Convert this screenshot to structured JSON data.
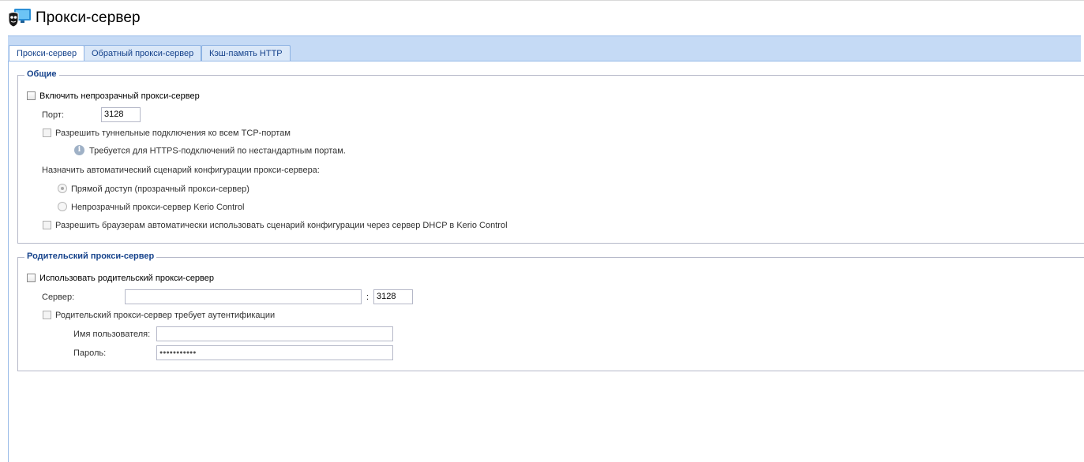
{
  "header": {
    "title": "Прокси-сервер"
  },
  "tabs": [
    {
      "label": "Прокси-сервер",
      "active": true
    },
    {
      "label": "Обратный прокси-сервер",
      "active": false
    },
    {
      "label": "Кэш-память HTTP",
      "active": false
    }
  ],
  "general": {
    "legend": "Общие",
    "enable_nontransparent": {
      "label": "Включить непрозрачный прокси-сервер",
      "checked": false
    },
    "port": {
      "label": "Порт:",
      "value": "3128"
    },
    "allow_tunnel": {
      "label": "Разрешить туннельные подключения ко всем TCP-портам",
      "checked": false
    },
    "tunnel_note": "Требуется для HTTPS-подключений по нестандартным портам.",
    "autoconfig_label": "Назначить автоматический сценарий конфигурации прокси-сервера:",
    "radio_direct": {
      "label": "Прямой доступ (прозрачный прокси-сервер)",
      "selected": true
    },
    "radio_kerio": {
      "label": "Непрозрачный прокси-сервер Kerio Control",
      "selected": false
    },
    "allow_dhcp": {
      "label": "Разрешить браузерам автоматически использовать сценарий конфигурации через сервер DHCP в Kerio Control",
      "checked": false
    }
  },
  "parent": {
    "legend": "Родительский прокси-сервер",
    "use_parent": {
      "label": "Использовать родительский прокси-сервер",
      "checked": false
    },
    "server": {
      "label": "Сервер:",
      "value": "",
      "separator": ":",
      "port": "3128"
    },
    "requires_auth": {
      "label": "Родительский прокси-сервер требует аутентификации",
      "checked": false
    },
    "username": {
      "label": "Имя пользователя:",
      "value": ""
    },
    "password": {
      "label": "Пароль:",
      "value": "●●●●●●●●●●●"
    }
  },
  "colors": {
    "tab_bar": "#c5daf5",
    "legend_text": "#15428b",
    "border": "#99bbe8"
  }
}
